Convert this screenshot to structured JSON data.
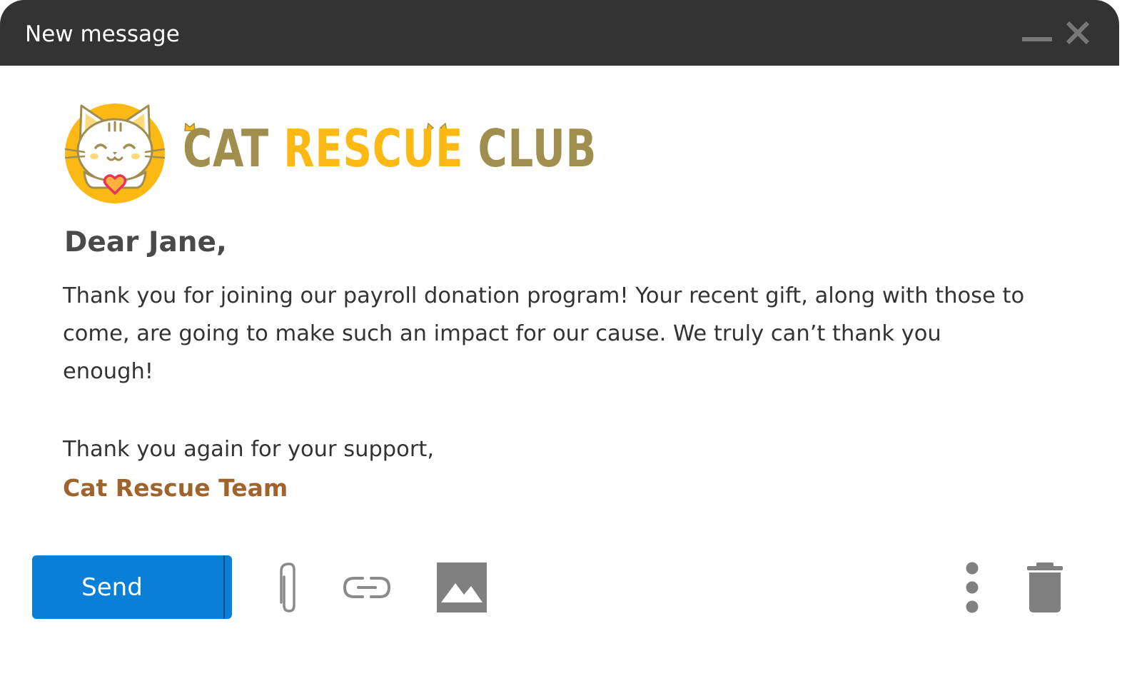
{
  "window": {
    "title": "New message",
    "minimize_icon": "minimize-icon",
    "close_icon": "close-icon",
    "titlebar_color": "#333333"
  },
  "brand": {
    "name_part1": "CAT ",
    "name_part2": "RESCUE ",
    "name_part3": "CLUB",
    "primary_color": "#a08e4f",
    "accent_color": "#fcb813",
    "logo_icon": "cat-logo-icon"
  },
  "message": {
    "greeting": "Dear Jane,",
    "body": "Thank you for joining our payroll donation program! Your recent gift, along with those to come, are going to make such an impact for our cause. We truly can’t thank you enough!",
    "closing": "Thank you again for your support,",
    "signature": "Cat Rescue Team",
    "signature_color": "#a0632c"
  },
  "toolbar": {
    "send_label": "Send",
    "send_color": "#0a7fd8",
    "send_options_icon": "caret-down-icon",
    "attach_icon": "paperclip-icon",
    "link_icon": "link-icon",
    "image_icon": "image-icon",
    "more_icon": "more-vertical-icon",
    "delete_icon": "trash-icon",
    "icon_color": "#808080"
  }
}
